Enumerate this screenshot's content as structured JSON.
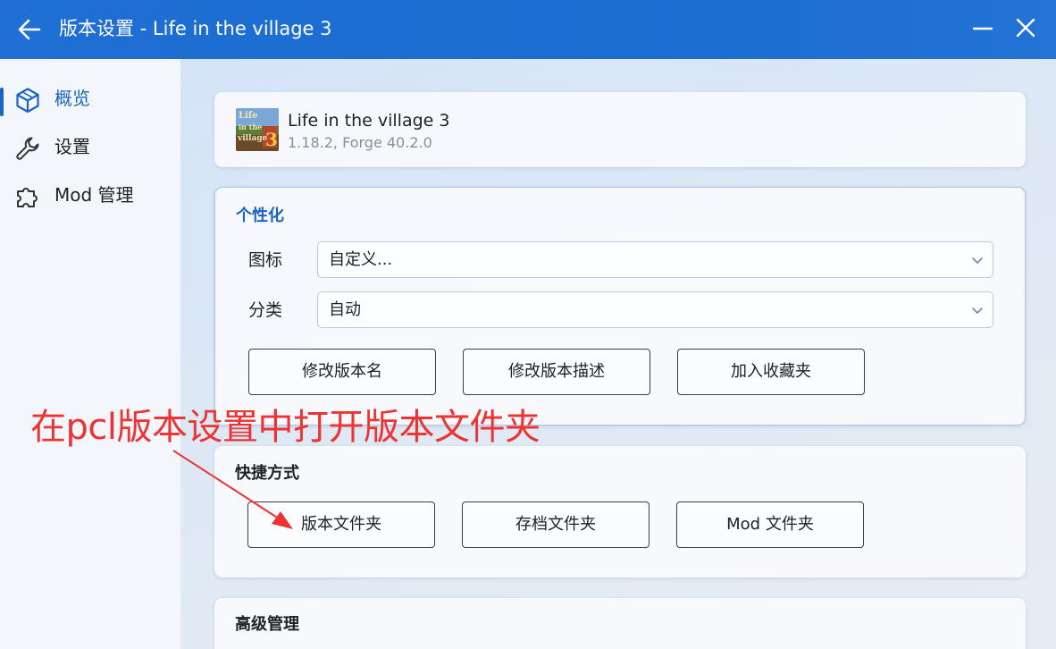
{
  "titlebar": {
    "title": "版本设置 - Life in the village 3",
    "back_icon": "arrow-left-icon",
    "minimize_icon": "minimize-icon",
    "close_icon": "close-icon"
  },
  "sidebar": {
    "items": [
      {
        "label": "概览",
        "icon": "cube-icon",
        "active": true
      },
      {
        "label": "设置",
        "icon": "wrench-icon",
        "active": false
      },
      {
        "label": "Mod 管理",
        "icon": "puzzle-icon",
        "active": false
      }
    ]
  },
  "version": {
    "name": "Life in the village 3",
    "subtitle": "1.18.2, Forge 40.2.0",
    "icon_text": [
      "Life",
      "in the",
      "village"
    ],
    "icon_number": "3"
  },
  "personalize": {
    "title": "个性化",
    "icon_label": "图标",
    "icon_value": "自定义...",
    "category_label": "分类",
    "category_value": "自动",
    "buttons": [
      "修改版本名",
      "修改版本描述",
      "加入收藏夹"
    ]
  },
  "shortcuts": {
    "title": "快捷方式",
    "buttons": [
      "版本文件夹",
      "存档文件夹",
      "Mod 文件夹"
    ]
  },
  "advanced": {
    "title": "高级管理"
  },
  "annotation": {
    "text": "在pcl版本设置中打开版本文件夹",
    "color": "#ee3333"
  },
  "colors": {
    "titlebar": "#1f6fd4",
    "accent": "#1a63c7"
  }
}
